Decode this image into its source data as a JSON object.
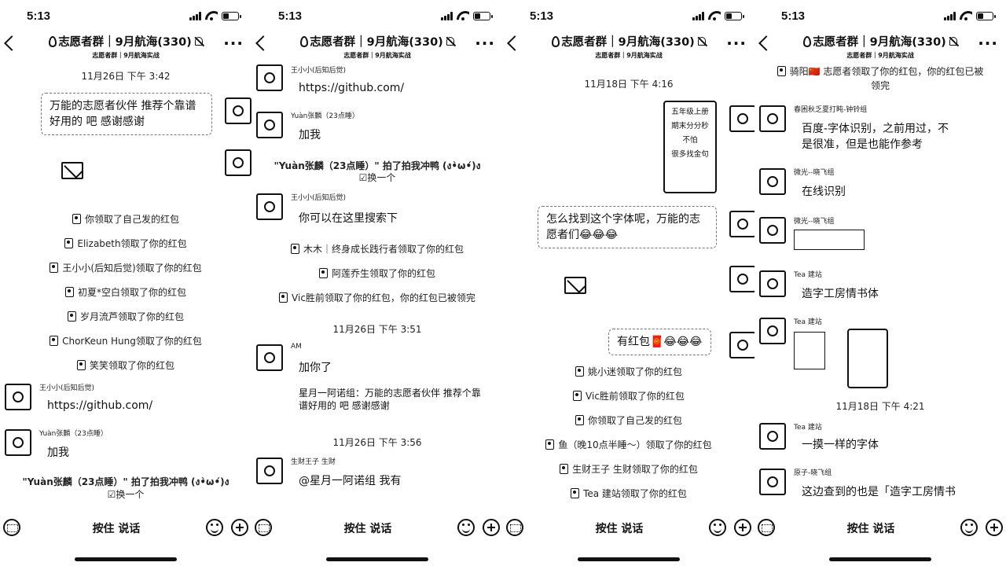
{
  "status": {
    "time": "5:13"
  },
  "header": {
    "title": "志愿者群｜9月航海(330)",
    "subtitle": "志愿者群｜9月航海实战"
  },
  "bottom": {
    "voice_label": "按住 说话"
  },
  "p1": {
    "time1": "11月26日 下午 3:42",
    "q1": "万能的志愿者伙伴  推荐个靠谱好用的        吧  感谢感谢",
    "sys1": "你领取了自己发的红包",
    "sys2": "Elizabeth领取了你的红包",
    "sys3": "王小小(后知后觉)领取了你的红包",
    "sys4": "初夏*空白领取了你的红包",
    "sys5": "岁月流芦领取了你的红包",
    "sys6": "ChorKeun Hung领取了你的红包",
    "sys7": "笑笑领取了你的红包",
    "n1": "王小小(后知后觉)",
    "m1": "https://github.com/",
    "n2": "Yuàn张麟（23点睡）",
    "m2": "加我",
    "pat": "\"Yuàn张麟（23点睡）\" 拍了拍我冲鸭 (ง•̀ω•́)ง",
    "swap": "☑换一个"
  },
  "p2": {
    "n1": "王小小(后知后觉)",
    "m1": "https://github.com/",
    "n2": "Yuàn张麟（23点睡）",
    "m2": "加我",
    "pat": "\"Yuàn张麟（23点睡）\" 拍了拍我冲鸭 (ง•̀ω•́)ง",
    "swap": "☑换一个",
    "n3": "王小小(后知后觉)",
    "m3": "你可以在这里搜索下",
    "sys1": "木木｜终身成长践行者领取了你的红包",
    "sys2": "阿莲乔生领取了你的红包",
    "sys3": "Vic胜前领取了你的红包，你的红包已被领完",
    "time1": "11月26日 下午 3:51",
    "n4": "AM",
    "m4": "加你了",
    "m5": "星月一阿诺组：万能的志愿者伙伴  推荐个靠谱好用的        吧  感谢感谢",
    "time2": "11月26日 下午 3:56",
    "n5": "生财王子 生财",
    "m6": "@星月一阿诺组 我有"
  },
  "p3": {
    "time1": "11月18日 下午 4:16",
    "img_l1": "五年级上册",
    "img_l2": "期末分分秒不怕",
    "img_l3": "很多找金句",
    "q1": "怎么找到这个字体呢，万能的志愿者们😂😂😂",
    "q2": "有红包🧧😂😂😂",
    "sys1": "姚小迷领取了你的红包",
    "sys2": "Vic胜前领取了你的红包",
    "sys3": "你领取了自己发的红包",
    "sys4": "鱼（晚10点半睡～）领取了你的红包",
    "sys5": "生财王子 生财领取了你的红包",
    "sys6": "Tea 建站领取了你的红包"
  },
  "p4": {
    "sys1": "骑阳🇨🇳 志愿者领取了你的红包，你的红包已被领完",
    "n1": "春困秋乏夏打盹-钟铃组",
    "m1": "百度-字体识别，之前用过，不是很准，但是也能作参考",
    "n2": "微光--晓飞组",
    "m2": "在线识别",
    "n3": "微光--晓飞组",
    "n4": "Tea 建站",
    "m4": "造字工房情书体",
    "n5": "Tea 建站",
    "time1": "11月18日 下午 4:21",
    "n6": "Tea 建站",
    "m6": "一摸一样的字体",
    "n7": "原子-晓飞组",
    "m7": "这边查到的也是「造字工房情书"
  }
}
